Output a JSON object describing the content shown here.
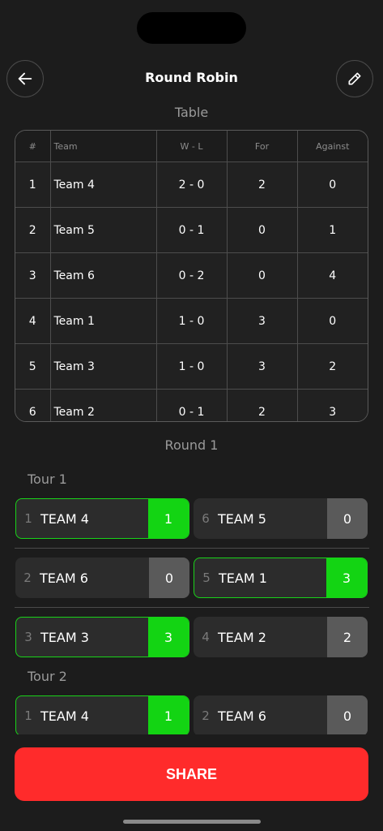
{
  "header": {
    "title": "Round Robin"
  },
  "standings": {
    "label": "Table",
    "columns": [
      "#",
      "Team",
      "W - L",
      "For",
      "Against"
    ],
    "rows": [
      [
        "1",
        "Team 4",
        "2 - 0",
        "2",
        "0"
      ],
      [
        "2",
        "Team 5",
        "0 - 1",
        "0",
        "1"
      ],
      [
        "3",
        "Team 6",
        "0 - 2",
        "0",
        "4"
      ],
      [
        "4",
        "Team 1",
        "1 - 0",
        "3",
        "0"
      ],
      [
        "5",
        "Team 3",
        "1 - 0",
        "3",
        "2"
      ],
      [
        "6",
        "Team 2",
        "0 - 1",
        "2",
        "3"
      ]
    ]
  },
  "round": {
    "label": "Round 1",
    "tours": [
      {
        "label": "Tour 1",
        "matches": [
          [
            {
              "seed": "1",
              "team": "TEAM 4",
              "score": "1",
              "win": true
            },
            {
              "seed": "6",
              "team": "TEAM 5",
              "score": "0",
              "win": false
            }
          ],
          [
            {
              "seed": "2",
              "team": "TEAM 6",
              "score": "0",
              "win": false
            },
            {
              "seed": "5",
              "team": "TEAM 1",
              "score": "3",
              "win": true
            }
          ],
          [
            {
              "seed": "3",
              "team": "TEAM 3",
              "score": "3",
              "win": true
            },
            {
              "seed": "4",
              "team": "TEAM 2",
              "score": "2",
              "win": false
            }
          ]
        ]
      },
      {
        "label": "Tour 2",
        "matches": [
          [
            {
              "seed": "1",
              "team": "TEAM 4",
              "score": "1",
              "win": true
            },
            {
              "seed": "2",
              "team": "TEAM 6",
              "score": "0",
              "win": false
            }
          ]
        ]
      }
    ]
  },
  "share_label": "SHARE",
  "icons": {
    "back": "arrow-left-icon",
    "edit": "pencil-icon"
  },
  "colors": {
    "background": "#1c1c1c",
    "win": "#13d413",
    "share": "#ff2b2b"
  }
}
